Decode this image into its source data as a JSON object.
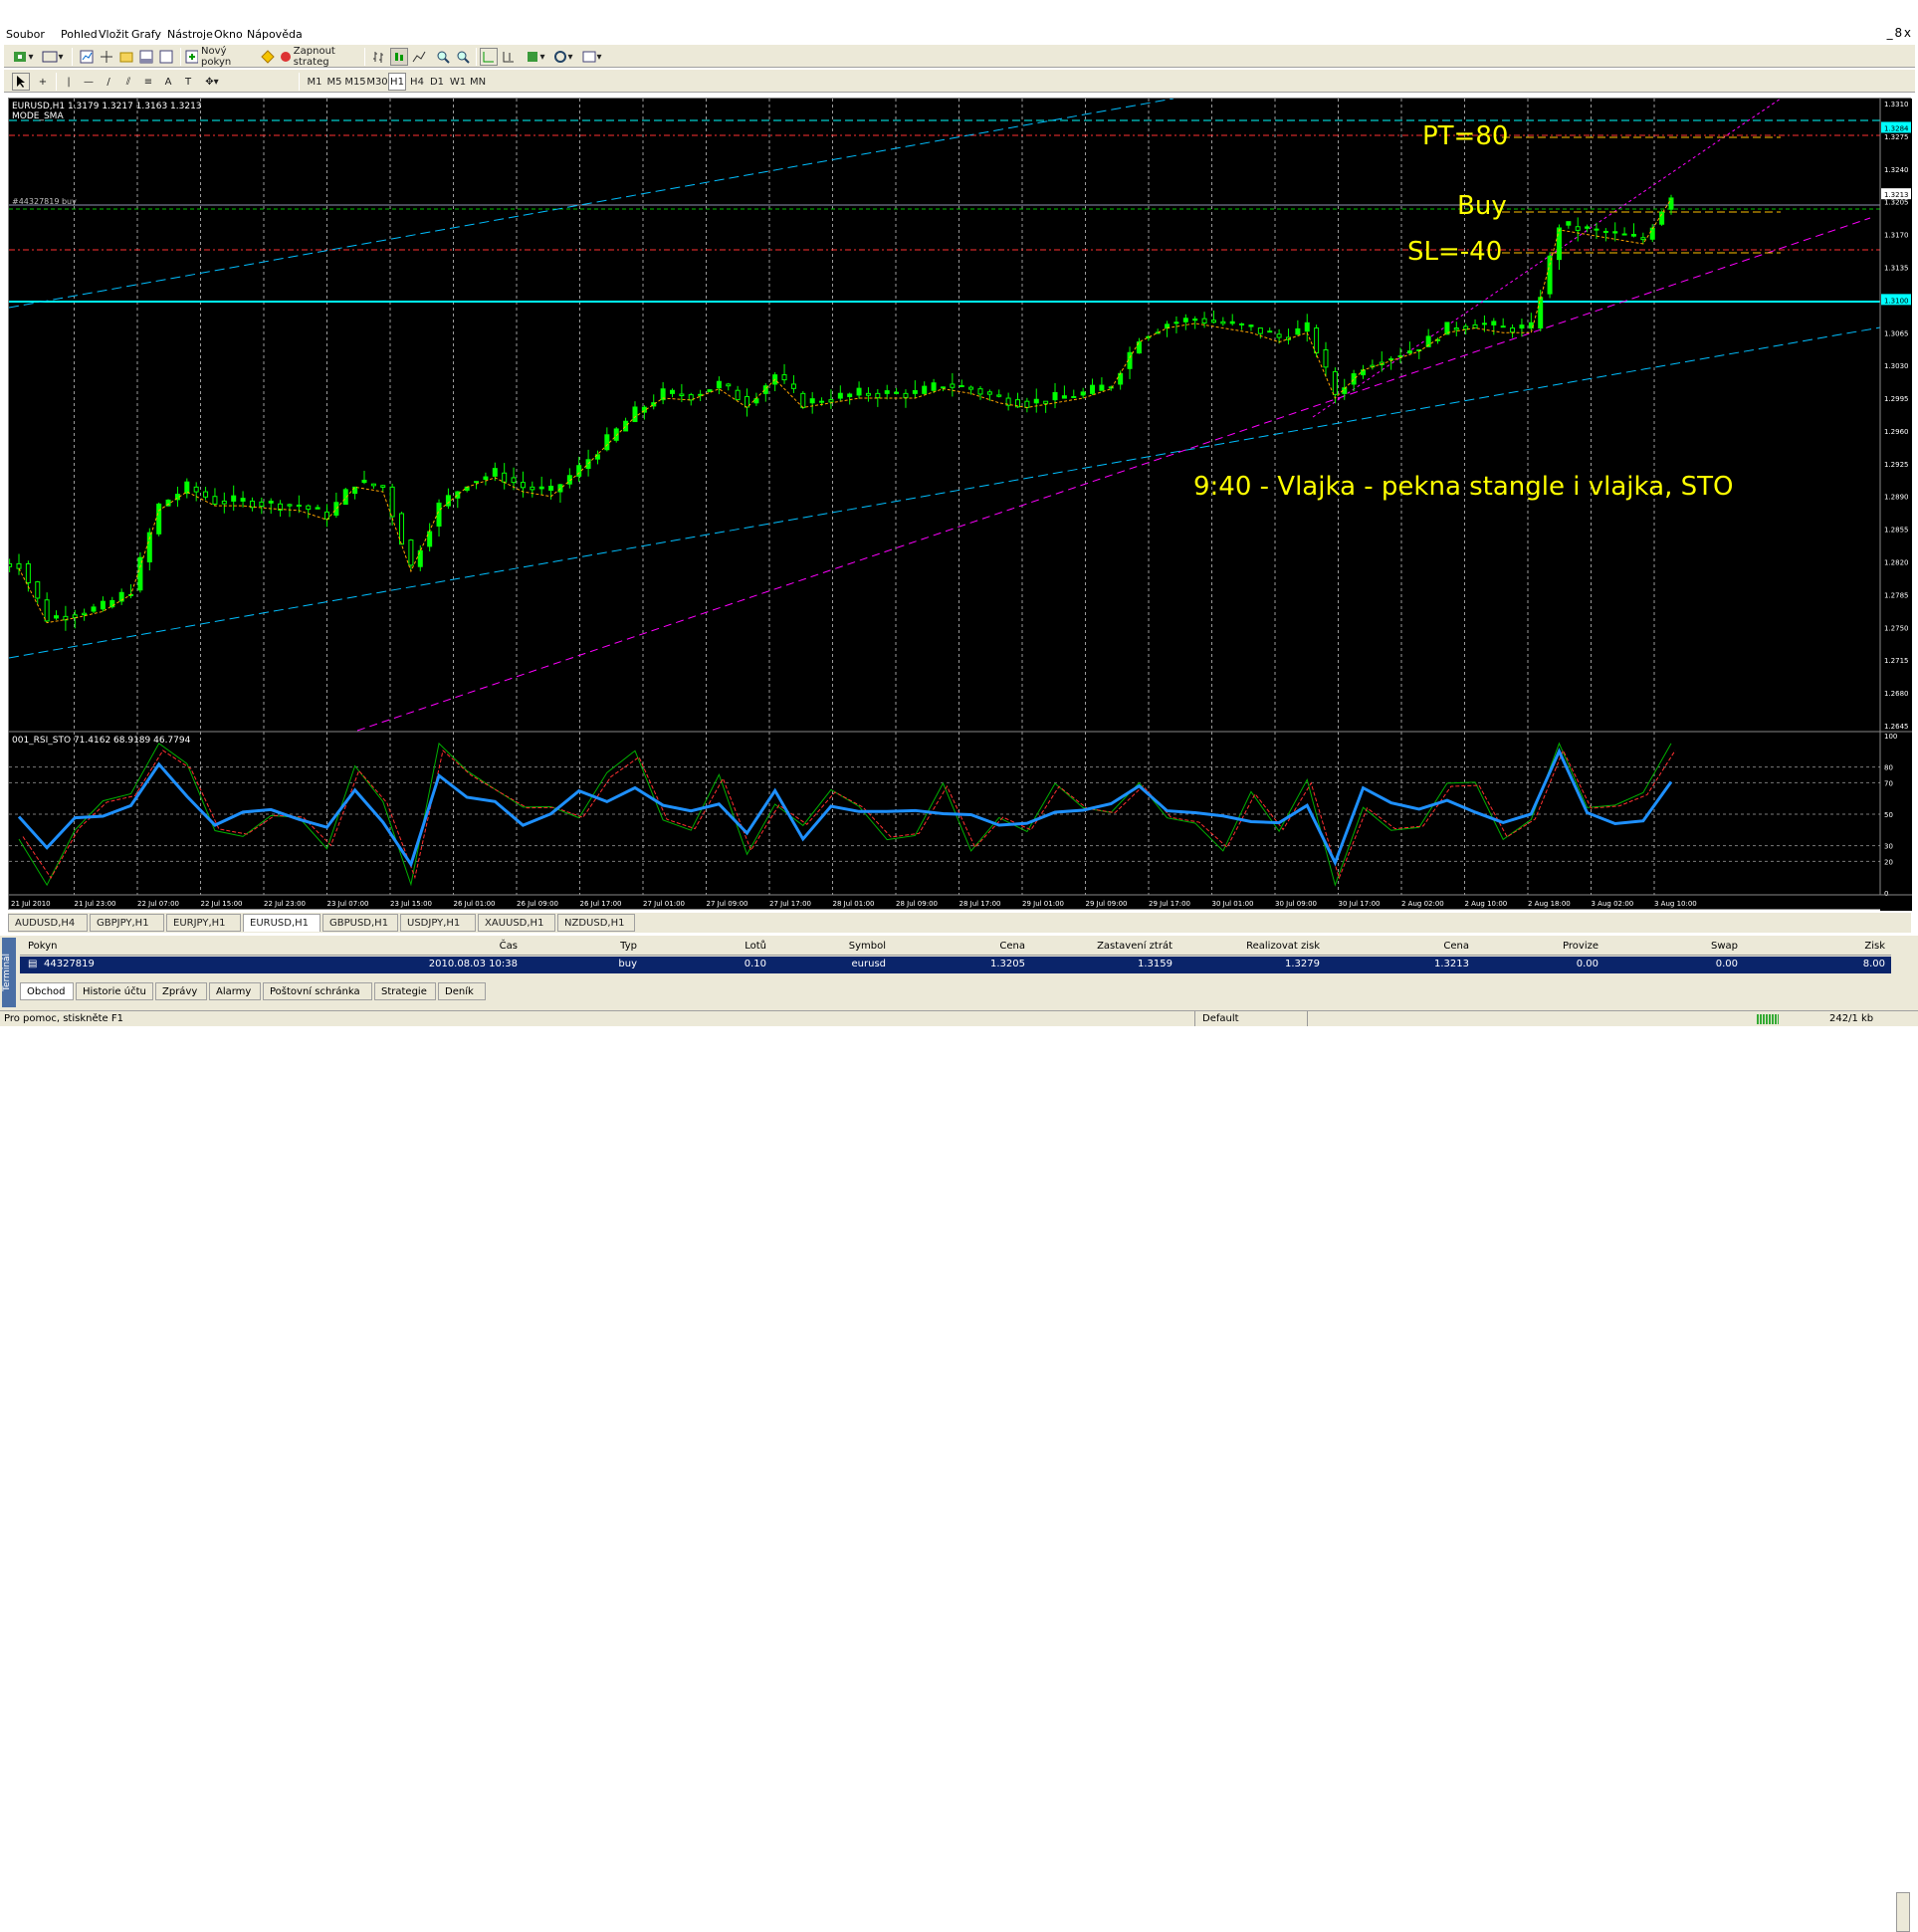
{
  "menu": [
    "Soubor",
    "Pohled",
    "Vložit",
    "Grafy",
    "Nástroje",
    "Okno",
    "Nápověda"
  ],
  "mdi_controls": "_ 8 x",
  "toolbar1": {
    "new_order": "Nový pokyn",
    "autotrade": "Zapnout strateg"
  },
  "timeframes": [
    "M1",
    "M5",
    "M15",
    "M30",
    "H1",
    "H4",
    "D1",
    "W1",
    "MN"
  ],
  "draw_tools": [
    "A",
    "T"
  ],
  "chart": {
    "info_line": "EURUSD,H1  1.3179 1.3217 1.3163 1.3213",
    "indicator_name": "MODE_SMA",
    "order_label": "#44327819 buy",
    "price_labels": [
      "1.3310",
      "1.3284",
      "1.3275",
      "1.3240",
      "1.3213",
      "1.3205",
      "1.3170",
      "1.3135",
      "1.3100",
      "1.3065",
      "1.3030",
      "1.2995",
      "1.2960",
      "1.2925",
      "1.2890",
      "1.2855",
      "1.2820",
      "1.2785",
      "1.2750",
      "1.2715",
      "1.2680",
      "1.2645"
    ],
    "highlight_labels": {
      "pt": "1.3284",
      "current": "1.3213",
      "level": "1.3100"
    },
    "annotations": {
      "pt": "PT=80",
      "buy": "Buy",
      "sl": "SL=-40",
      "note": "9:40 - Vlajka - pekna stangle i vlajka, STO"
    },
    "time_labels": [
      "21 Jul 2010",
      "21 Jul 23:00",
      "22 Jul 07:00",
      "22 Jul 15:00",
      "22 Jul 23:00",
      "23 Jul 07:00",
      "23 Jul 15:00",
      "26 Jul 01:00",
      "26 Jul 09:00",
      "26 Jul 17:00",
      "27 Jul 01:00",
      "27 Jul 09:00",
      "27 Jul 17:00",
      "28 Jul 01:00",
      "28 Jul 09:00",
      "28 Jul 17:00",
      "29 Jul 01:00",
      "29 Jul 09:00",
      "29 Jul 17:00",
      "30 Jul 01:00",
      "30 Jul 09:00",
      "30 Jul 17:00",
      "2 Aug 02:00",
      "2 Aug 10:00",
      "2 Aug 18:00",
      "3 Aug 02:00",
      "3 Aug 10:00"
    ],
    "sub_info": "001_RSI_STO 71.4162 68.9189 46.7794",
    "sub_levels": [
      "100",
      "80",
      "70",
      "50",
      "30",
      "20",
      "0"
    ],
    "colors": {
      "bull": "#00ff00",
      "bear": "#ffffff",
      "cyan": "#00ffff",
      "magenta": "#ff00ff",
      "annot": "#ffff00",
      "sl": "#ff0000",
      "rsi": "#1e90ff"
    }
  },
  "chart_data": {
    "type": "line",
    "title": "EURUSD,H1",
    "series": [
      {
        "name": "EURUSD",
        "values": [
          1.2818,
          1.276,
          1.2765,
          1.2772,
          1.279,
          1.288,
          1.29,
          1.2885,
          1.2885,
          1.2882,
          1.288,
          1.287,
          1.2905,
          1.29,
          1.2815,
          1.288,
          1.2905,
          1.2915,
          1.29,
          1.2895,
          1.292,
          1.295,
          1.298,
          1.3,
          1.2998,
          1.301,
          1.299,
          1.302,
          1.299,
          1.2995,
          1.3,
          1.3,
          1.3,
          1.301,
          1.3005,
          1.2995,
          1.299,
          1.2995,
          1.3,
          1.301,
          1.306,
          1.3075,
          1.308,
          1.3075,
          1.307,
          1.306,
          1.307,
          1.3,
          1.303,
          1.304,
          1.305,
          1.307,
          1.3075,
          1.307,
          1.307,
          1.318,
          1.3175,
          1.317,
          1.3165,
          1.3213
        ]
      }
    ],
    "ylim": [
      1.2645,
      1.331
    ]
  },
  "tabs": [
    "AUDUSD,H4",
    "GBPJPY,H1",
    "EURJPY,H1",
    "EURUSD,H1",
    "GBPUSD,H1",
    "USDJPY,H1",
    "XAUUSD,H1",
    "NZDUSD,H1"
  ],
  "terminal": {
    "label": "Terminál",
    "headers": [
      "Pokyn",
      "Čas",
      "Typ",
      "Lotů",
      "Symbol",
      "Cena",
      "Zastavení ztrát",
      "Realizovat zisk",
      "Cena",
      "Provize",
      "Swap",
      "Zisk"
    ],
    "row": [
      "44327819",
      "2010.08.03 10:38",
      "buy",
      "0.10",
      "eurusd",
      "1.3205",
      "1.3159",
      "1.3279",
      "1.3213",
      "0.00",
      "0.00",
      "8.00"
    ],
    "tabs": [
      "Obchod",
      "Historie účtu",
      "Zprávy",
      "Alarmy",
      "Poštovní schránka",
      "Strategie",
      "Deník"
    ]
  },
  "status": {
    "help": "Pro pomoc, stiskněte F1",
    "profile": "Default",
    "traffic": "242/1 kb"
  }
}
